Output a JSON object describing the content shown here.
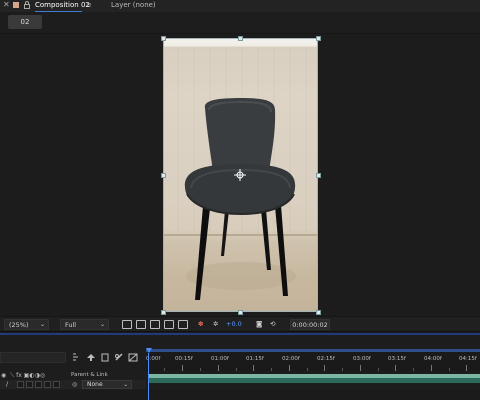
{
  "panel": {
    "comp_tab_label": "Composition 02",
    "menu_icon": "hamburger-icon",
    "layer_label": "Layer (none)"
  },
  "breadcrumb": {
    "comp_button": "02"
  },
  "toolbar": {
    "magnification": "(25%)",
    "resolution": "Full",
    "exposure": "+0.0",
    "timecode": "0:00:00:02"
  },
  "timeline": {
    "ruler_labels": [
      "0:00f",
      "00:15f",
      "01:00f",
      "01:15f",
      "02:00f",
      "02:15f",
      "03:00f",
      "03:15f",
      "04:00f",
      "04:15f"
    ],
    "parent_column_label": "Parent & Link",
    "parent_value": "None",
    "track_color": "#7ab8a4"
  },
  "colors": {
    "accent_blue": "#4a8cf7",
    "label_swatch": "#d4a58a"
  }
}
